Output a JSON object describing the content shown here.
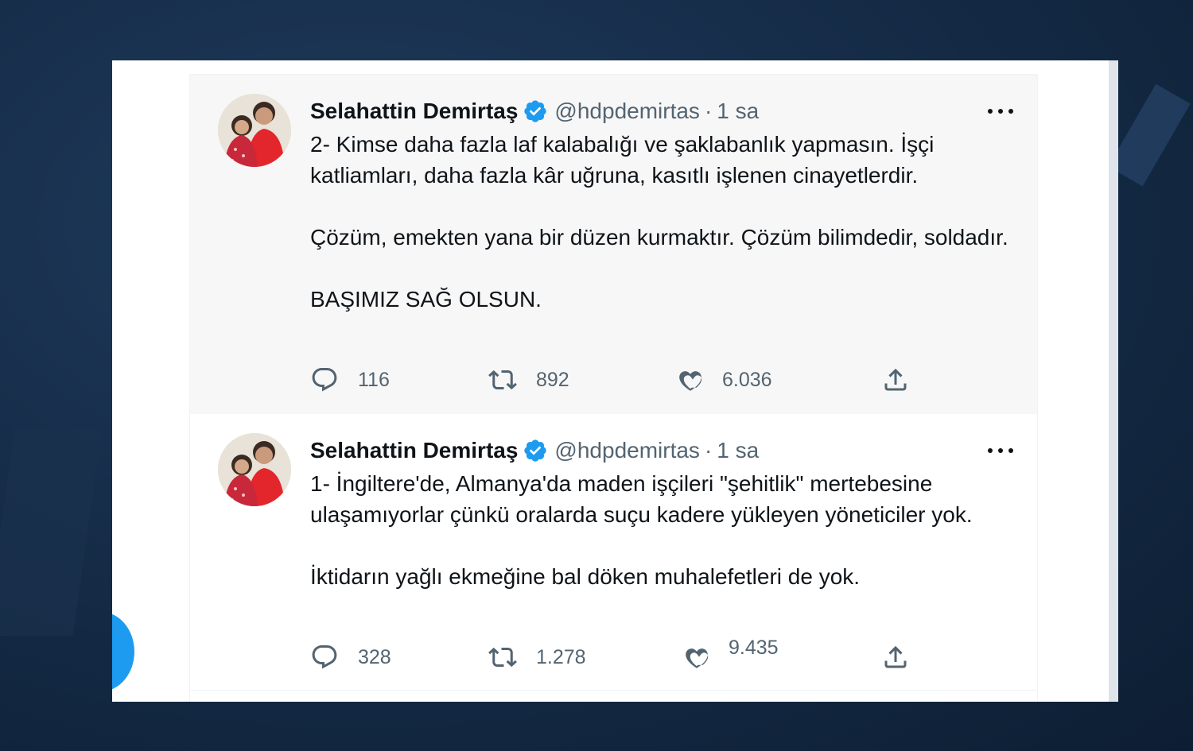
{
  "tweets": [
    {
      "name": "Selahattin Demirtaş",
      "handle": "@hdpdemirtas",
      "separator": "·",
      "time": "1 sa",
      "paragraphs": [
        "2- Kimse daha fazla laf kalabalığı ve şaklabanlık yapmasın. İşçi katliamları, daha fazla kâr uğruna, kasıtlı işlenen cinayetlerdir.",
        "Çözüm, emekten yana bir düzen kurmaktır. Çözüm bilimdedir, soldadır.",
        "BAŞIMIZ SAĞ OLSUN."
      ],
      "replies": "116",
      "retweets": "892",
      "likes": "6.036"
    },
    {
      "name": "Selahattin Demirtaş",
      "handle": "@hdpdemirtas",
      "separator": "·",
      "time": "1 sa",
      "paragraphs": [
        "1- İngiltere'de, Almanya'da maden işçileri \"şehitlik\" mertebesine ulaşamıyorlar çünkü oralarda suçu kadere yükleyen yöneticiler yok.",
        "İktidarın yağlı ekmeğine bal döken muhalefetleri de yok."
      ],
      "replies": "328",
      "retweets": "1.278",
      "likes": "9.435"
    }
  ],
  "colors": {
    "verified": "#1d9bf0",
    "secondary_text": "#536471",
    "primary_text": "#0f1419"
  },
  "icons": [
    "verified-badge-icon",
    "more-icon",
    "reply-icon",
    "retweet-icon",
    "like-icon",
    "share-icon"
  ]
}
